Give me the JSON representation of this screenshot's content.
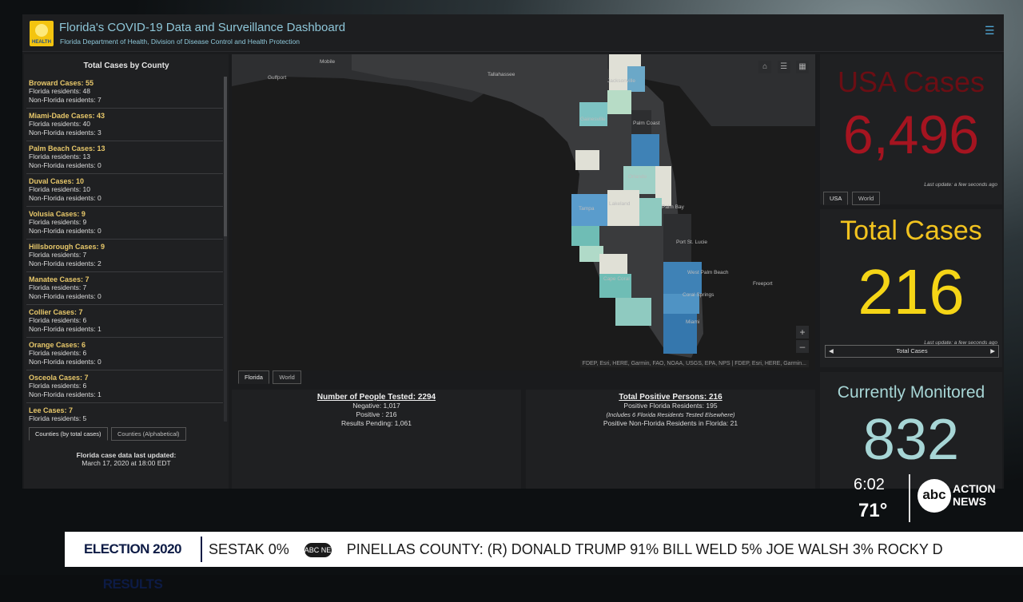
{
  "header": {
    "title": "Florida's COVID-19 Data and Surveillance Dashboard",
    "subtitle": "Florida Department of Health, Division of Disease Control and Health Protection",
    "logo_text": "HEALTH"
  },
  "county_panel": {
    "title": "Total Cases by County",
    "counties": [
      {
        "name": "Broward Cases: 55",
        "fl": "Florida residents: 48",
        "nonfl": "Non-Florida residents: 7"
      },
      {
        "name": "Miami-Dade Cases: 43",
        "fl": "Florida residents: 40",
        "nonfl": "Non-Florida residents: 3"
      },
      {
        "name": "Palm Beach Cases: 13",
        "fl": "Florida residents: 13",
        "nonfl": "Non-Florida residents: 0"
      },
      {
        "name": "Duval Cases: 10",
        "fl": "Florida residents: 10",
        "nonfl": "Non-Florida residents: 0"
      },
      {
        "name": "Volusia Cases: 9",
        "fl": "Florida residents: 9",
        "nonfl": "Non-Florida residents: 0"
      },
      {
        "name": "Hillsborough Cases: 9",
        "fl": "Florida residents: 7",
        "nonfl": "Non-Florida residents: 2"
      },
      {
        "name": "Manatee Cases: 7",
        "fl": "Florida residents: 7",
        "nonfl": "Non-Florida residents: 0"
      },
      {
        "name": "Collier Cases: 7",
        "fl": "Florida residents: 6",
        "nonfl": "Non-Florida residents: 1"
      },
      {
        "name": "Orange Cases: 6",
        "fl": "Florida residents: 6",
        "nonfl": "Non-Florida residents: 0"
      },
      {
        "name": "Osceola Cases: 7",
        "fl": "Florida residents: 6",
        "nonfl": "Non-Florida residents: 1"
      },
      {
        "name": "Lee Cases: 7",
        "fl": "Florida residents: 5",
        "nonfl": ""
      }
    ],
    "tabs": [
      "Counties (by total cases)",
      "Counties (Alphabetical)"
    ],
    "footer_title": "Florida case data last updated:",
    "footer_date": "March 17, 2020 at 18:00 EDT"
  },
  "map": {
    "labels": {
      "mobile": "Mobile",
      "gulfport": "Gulfport",
      "tallahassee": "Tallahassee",
      "jacksonville": "Jacksonville",
      "gainesville": "Gainesville",
      "palm_coast": "Palm Coast",
      "orlando": "Orlando",
      "tampa": "Tampa",
      "lakeland": "Lakeland",
      "palm_bay": "Palm Bay",
      "port_st_lucie": "Port St. Lucie",
      "west_palm": "West Palm Beach",
      "cape_coral": "Cape Coral",
      "coral_springs": "Coral Springs",
      "miami": "Miami",
      "freeport": "Freeport"
    },
    "attribution": "FDEP, Esri, HERE, Garmin, FAO, NOAA, USGS, EPA, NPS | FDEP, Esri, HERE, Garmin...",
    "tabs": [
      "Florida",
      "World"
    ]
  },
  "tested": {
    "title": "Number of People Tested: 2294",
    "negative": "Negative: 1,017",
    "positive": "Positive : 216",
    "pending": "Results Pending: 1,061"
  },
  "positive": {
    "title": "Total Positive Persons: 216",
    "fl_residents": "Positive Florida Residents: 195",
    "note": "(Includes 6 Florida Residents Tested Elsewhere)",
    "non_fl": "Positive Non-Florida Residents in Florida: 21"
  },
  "usa": {
    "title": "USA Cases",
    "value": "6,496",
    "updated": "Last update: a few seconds ago",
    "tabs": [
      "USA",
      "World"
    ]
  },
  "total": {
    "title": "Total Cases",
    "value": "216",
    "updated": "Last update: a few seconds ago",
    "carousel": "Total Cases"
  },
  "monitored": {
    "title": "Currently Monitored",
    "value": "832"
  },
  "tv": {
    "time": "6:02",
    "temp": "71°",
    "station_circle": "abc",
    "station_text": "ACTION NEWS",
    "ticker_label": "ELECTION 2020 RESULTS",
    "ticker_part1": "SESTAK 0%",
    "ticker_abc": "ABC NEWS",
    "ticker_part2": "PINELLAS COUNTY: (R) DONALD TRUMP 91% BILL WELD 5% JOE WALSH 3% ROCKY D"
  },
  "colors": {
    "usa_red": "#a51420",
    "total_yellow": "#f5d516",
    "monitored_teal": "#a7d6d6",
    "title_blue": "#8ec7d9"
  }
}
